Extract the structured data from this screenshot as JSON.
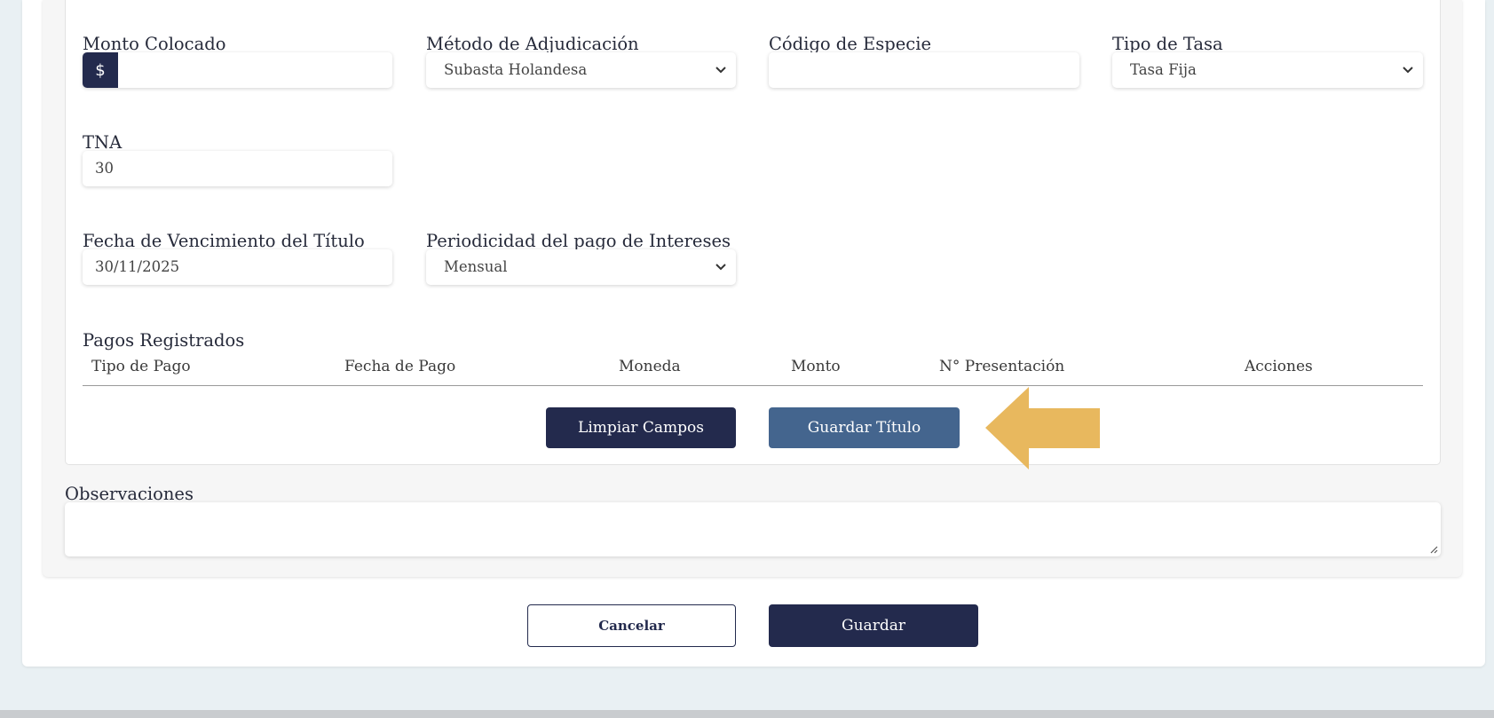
{
  "fields": {
    "monto_colocado": {
      "label": "Monto Colocado",
      "prefix": "$",
      "value": ""
    },
    "metodo_adjudicacion": {
      "label": "Método de Adjudicación",
      "value": "Subasta Holandesa"
    },
    "codigo_especie": {
      "label": "Código de Especie",
      "value": ""
    },
    "tipo_tasa": {
      "label": "Tipo de Tasa",
      "value": "Tasa Fija"
    },
    "tna": {
      "label": "TNA",
      "value": "30"
    },
    "fecha_vencimiento": {
      "label": "Fecha de Vencimiento del Título",
      "value": "30/11/2025"
    },
    "periodicidad": {
      "label": "Periodicidad del pago de Intereses",
      "value": "Mensual"
    }
  },
  "pagos": {
    "title": "Pagos Registrados",
    "columns": [
      "Tipo de Pago",
      "Fecha de Pago",
      "Moneda",
      "Monto",
      "N° Presentación",
      "Acciones"
    ]
  },
  "buttons": {
    "limpiar": "Limpiar Campos",
    "guardar_titulo": "Guardar Título",
    "cancelar": "Cancelar",
    "guardar": "Guardar"
  },
  "observaciones": {
    "label": "Observaciones",
    "value": ""
  },
  "colors": {
    "primary": "#232a4d",
    "secondary": "#44658e",
    "arrow": "#e8b85e",
    "page_bg": "#e9f0f3"
  },
  "icons": {
    "select_chevron": "chevron-down-icon",
    "pointer": "left-arrow-icon",
    "resize": "resize-handle-icon"
  }
}
